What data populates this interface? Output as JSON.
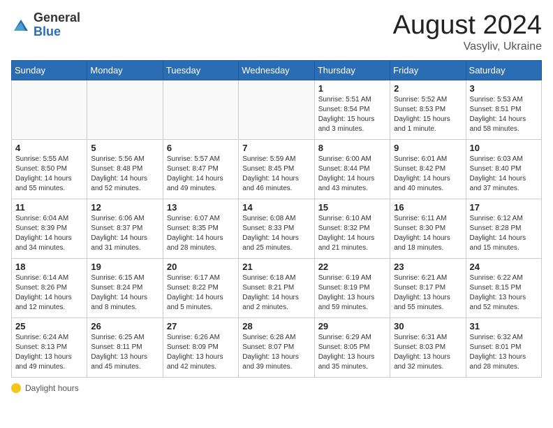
{
  "header": {
    "logo_general": "General",
    "logo_blue": "Blue",
    "month_year": "August 2024",
    "location": "Vasyliv, Ukraine"
  },
  "legend": {
    "label": "Daylight hours"
  },
  "weekdays": [
    "Sunday",
    "Monday",
    "Tuesday",
    "Wednesday",
    "Thursday",
    "Friday",
    "Saturday"
  ],
  "weeks": [
    [
      {
        "day": "",
        "info": ""
      },
      {
        "day": "",
        "info": ""
      },
      {
        "day": "",
        "info": ""
      },
      {
        "day": "",
        "info": ""
      },
      {
        "day": "1",
        "info": "Sunrise: 5:51 AM\nSunset: 8:54 PM\nDaylight: 15 hours\nand 3 minutes."
      },
      {
        "day": "2",
        "info": "Sunrise: 5:52 AM\nSunset: 8:53 PM\nDaylight: 15 hours\nand 1 minute."
      },
      {
        "day": "3",
        "info": "Sunrise: 5:53 AM\nSunset: 8:51 PM\nDaylight: 14 hours\nand 58 minutes."
      }
    ],
    [
      {
        "day": "4",
        "info": "Sunrise: 5:55 AM\nSunset: 8:50 PM\nDaylight: 14 hours\nand 55 minutes."
      },
      {
        "day": "5",
        "info": "Sunrise: 5:56 AM\nSunset: 8:48 PM\nDaylight: 14 hours\nand 52 minutes."
      },
      {
        "day": "6",
        "info": "Sunrise: 5:57 AM\nSunset: 8:47 PM\nDaylight: 14 hours\nand 49 minutes."
      },
      {
        "day": "7",
        "info": "Sunrise: 5:59 AM\nSunset: 8:45 PM\nDaylight: 14 hours\nand 46 minutes."
      },
      {
        "day": "8",
        "info": "Sunrise: 6:00 AM\nSunset: 8:44 PM\nDaylight: 14 hours\nand 43 minutes."
      },
      {
        "day": "9",
        "info": "Sunrise: 6:01 AM\nSunset: 8:42 PM\nDaylight: 14 hours\nand 40 minutes."
      },
      {
        "day": "10",
        "info": "Sunrise: 6:03 AM\nSunset: 8:40 PM\nDaylight: 14 hours\nand 37 minutes."
      }
    ],
    [
      {
        "day": "11",
        "info": "Sunrise: 6:04 AM\nSunset: 8:39 PM\nDaylight: 14 hours\nand 34 minutes."
      },
      {
        "day": "12",
        "info": "Sunrise: 6:06 AM\nSunset: 8:37 PM\nDaylight: 14 hours\nand 31 minutes."
      },
      {
        "day": "13",
        "info": "Sunrise: 6:07 AM\nSunset: 8:35 PM\nDaylight: 14 hours\nand 28 minutes."
      },
      {
        "day": "14",
        "info": "Sunrise: 6:08 AM\nSunset: 8:33 PM\nDaylight: 14 hours\nand 25 minutes."
      },
      {
        "day": "15",
        "info": "Sunrise: 6:10 AM\nSunset: 8:32 PM\nDaylight: 14 hours\nand 21 minutes."
      },
      {
        "day": "16",
        "info": "Sunrise: 6:11 AM\nSunset: 8:30 PM\nDaylight: 14 hours\nand 18 minutes."
      },
      {
        "day": "17",
        "info": "Sunrise: 6:12 AM\nSunset: 8:28 PM\nDaylight: 14 hours\nand 15 minutes."
      }
    ],
    [
      {
        "day": "18",
        "info": "Sunrise: 6:14 AM\nSunset: 8:26 PM\nDaylight: 14 hours\nand 12 minutes."
      },
      {
        "day": "19",
        "info": "Sunrise: 6:15 AM\nSunset: 8:24 PM\nDaylight: 14 hours\nand 8 minutes."
      },
      {
        "day": "20",
        "info": "Sunrise: 6:17 AM\nSunset: 8:22 PM\nDaylight: 14 hours\nand 5 minutes."
      },
      {
        "day": "21",
        "info": "Sunrise: 6:18 AM\nSunset: 8:21 PM\nDaylight: 14 hours\nand 2 minutes."
      },
      {
        "day": "22",
        "info": "Sunrise: 6:19 AM\nSunset: 8:19 PM\nDaylight: 13 hours\nand 59 minutes."
      },
      {
        "day": "23",
        "info": "Sunrise: 6:21 AM\nSunset: 8:17 PM\nDaylight: 13 hours\nand 55 minutes."
      },
      {
        "day": "24",
        "info": "Sunrise: 6:22 AM\nSunset: 8:15 PM\nDaylight: 13 hours\nand 52 minutes."
      }
    ],
    [
      {
        "day": "25",
        "info": "Sunrise: 6:24 AM\nSunset: 8:13 PM\nDaylight: 13 hours\nand 49 minutes."
      },
      {
        "day": "26",
        "info": "Sunrise: 6:25 AM\nSunset: 8:11 PM\nDaylight: 13 hours\nand 45 minutes."
      },
      {
        "day": "27",
        "info": "Sunrise: 6:26 AM\nSunset: 8:09 PM\nDaylight: 13 hours\nand 42 minutes."
      },
      {
        "day": "28",
        "info": "Sunrise: 6:28 AM\nSunset: 8:07 PM\nDaylight: 13 hours\nand 39 minutes."
      },
      {
        "day": "29",
        "info": "Sunrise: 6:29 AM\nSunset: 8:05 PM\nDaylight: 13 hours\nand 35 minutes."
      },
      {
        "day": "30",
        "info": "Sunrise: 6:31 AM\nSunset: 8:03 PM\nDaylight: 13 hours\nand 32 minutes."
      },
      {
        "day": "31",
        "info": "Sunrise: 6:32 AM\nSunset: 8:01 PM\nDaylight: 13 hours\nand 28 minutes."
      }
    ]
  ]
}
